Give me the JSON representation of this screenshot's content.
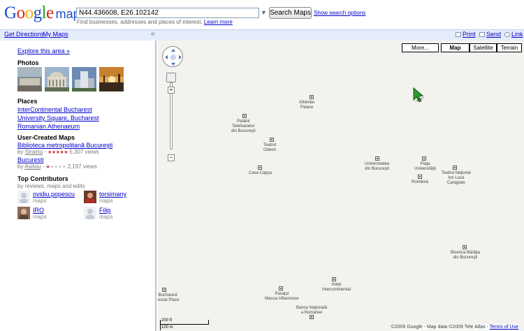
{
  "header": {
    "logo_text": "Google",
    "logo_maps": "maps",
    "search_value": "N44.436608, E26.102142",
    "search_button": "Search Maps",
    "show_options": "Show search options",
    "hint": "Find businesses, addresses and places of interest.",
    "learn_more": "Learn more"
  },
  "nav": {
    "get_directions": "Get Directions",
    "my_maps": "My Maps",
    "collapse": "«",
    "print": "Print",
    "send": "Send",
    "link": "Link"
  },
  "side": {
    "explore": "Explore this area »",
    "photos_title": "Photos",
    "photos": [
      {
        "color": "#7d8f95",
        "icon": "palace-photo"
      },
      {
        "color": "#9ab3cf",
        "icon": "athenaeum-photo"
      },
      {
        "color": "#6c8bb5",
        "icon": "tower-photo"
      },
      {
        "color": "#c9802e",
        "icon": "sunset-photo"
      }
    ],
    "places_title": "Places",
    "places": [
      "InterContinental Bucharest",
      "University Square, Bucharest",
      "Romanian Athenaeum"
    ],
    "ucm_title": "User-Created Maps",
    "ucm": [
      {
        "name": "Biblioteca metropolitană Bucureşti",
        "by": "by",
        "author": "Strainu",
        "views": "5,307 views"
      },
      {
        "name": "Bucuresti",
        "by": "by",
        "author": "Asilviu",
        "views": "2,197 views"
      }
    ],
    "contrib_title": "Top Contributors",
    "contrib_sub": "by reviews, maps and edits",
    "contributors": [
      {
        "name": "ovidiu.popescu",
        "sub": "maps"
      },
      {
        "name": "torsimany",
        "sub": "maps"
      },
      {
        "name": "IRO",
        "sub": "maps"
      },
      {
        "name": "Filip",
        "sub": "maps"
      }
    ]
  },
  "map": {
    "types": [
      "More...",
      "Map",
      "Satellite",
      "Terrain"
    ],
    "pois": [
      "Athénée\nPalace",
      "Palatul\nTelefoanelor\ndin Bucureşti",
      "Teatrul\nOdeon",
      "Casa Capşa",
      "Universitatea\ndin Bucureşti",
      "Piaţa\nUniversităţii",
      "Teatrul Naţional\nIon Luca\nCaragiale",
      "Romănia",
      "Biserica Bărăţia\ndin Bucureşti",
      "Hotel\nIntercontinental",
      "Pasajul\nMacca-Villacrosse",
      "Banca Naţională\na României",
      "Bucharest\nancial Plaza"
    ],
    "scale_ft": "200 ft",
    "scale_m": "100 m",
    "copyright": "©2009 Google - Map data ©2009 Tele Atlas -",
    "terms": "Terms of Use",
    "marker_color": "#2c9a2c"
  }
}
